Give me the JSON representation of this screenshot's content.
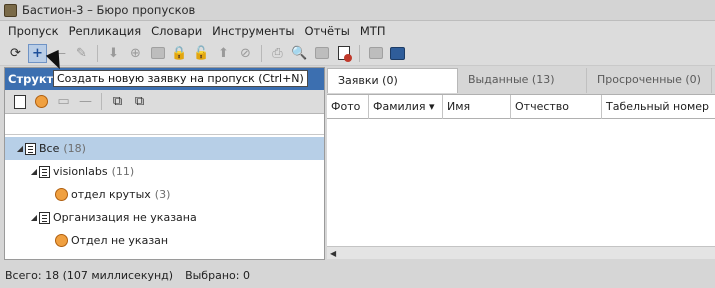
{
  "window": {
    "title": "Бастион-3 – Бюро пропусков"
  },
  "menu": [
    "Пропуск",
    "Репликация",
    "Словари",
    "Инструменты",
    "Отчёты",
    "МТП"
  ],
  "toolbar": {
    "icons": [
      "refresh-icon",
      "add-icon",
      "remove-icon",
      "edit-icon",
      "download-icon",
      "search-add-icon",
      "photo-icon",
      "lock-icon",
      "unlock-icon",
      "upload-icon",
      "cancel-icon",
      "print-icon",
      "search-person-icon",
      "card-icon",
      "pass-red-icon",
      "photo-gray-icon",
      "id-card-icon"
    ]
  },
  "tooltip": {
    "text": "Создать новую заявку на пропуск (Ctrl+N)"
  },
  "left_panel": {
    "header": "Структура",
    "tree": [
      {
        "label": "Все",
        "count": "(18)",
        "level": 0,
        "selected": true,
        "expanded": true
      },
      {
        "label": "visionlabs",
        "count": "(11)",
        "level": 1,
        "selected": false,
        "expanded": true
      },
      {
        "label": "отдел крутых",
        "count": "(3)",
        "level": 2,
        "selected": false,
        "expanded": false
      },
      {
        "label": "Организация не указана",
        "count": "",
        "level": 1,
        "selected": false,
        "expanded": true
      },
      {
        "label": "Отдел не указан",
        "count": "",
        "level": 2,
        "selected": false,
        "expanded": false
      }
    ]
  },
  "tabs": [
    "Заявки (0)",
    "Выданные (13)",
    "Просроченные (0)"
  ],
  "table": {
    "columns": [
      "Фото",
      "Фамилия ▾",
      "Имя",
      "Отчество",
      "Табельный номер"
    ]
  },
  "status": {
    "total": "Всего: 18 (107 миллисекунд)",
    "selected": "Выбрано: 0"
  }
}
